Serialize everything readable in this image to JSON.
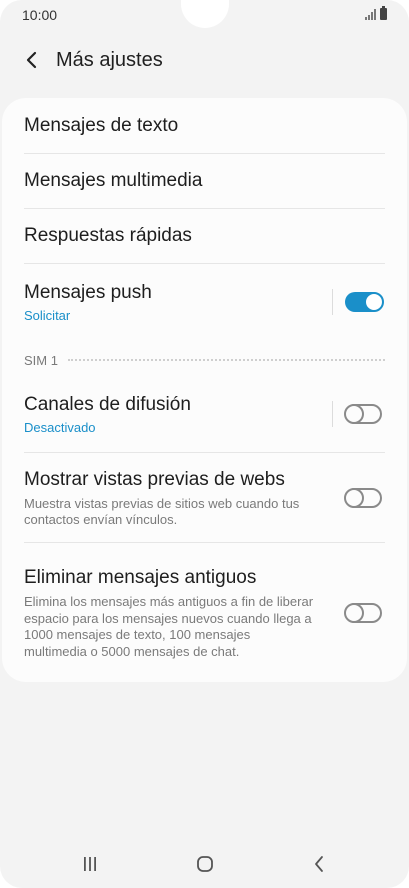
{
  "status_bar": {
    "time": "10:00"
  },
  "header": {
    "title": "Más ajustes"
  },
  "settings": {
    "text_messages": "Mensajes de texto",
    "multimedia_messages": "Mensajes multimedia",
    "quick_responses": "Respuestas rápidas",
    "push_messages": {
      "title": "Mensajes push",
      "subtitle": "Solicitar",
      "enabled": true
    },
    "sim_section": "SIM 1",
    "broadcast_channels": {
      "title": "Canales de difusión",
      "subtitle": "Desactivado",
      "enabled": false
    },
    "web_previews": {
      "title": "Mostrar vistas previas de webs",
      "subtitle": "Muestra vistas previas de sitios web cuando tus contactos envían vínculos.",
      "enabled": false
    },
    "delete_old": {
      "title": "Eliminar mensajes antiguos",
      "subtitle": "Elimina los mensajes más antiguos a fin de liberar espacio para los mensajes nuevos cuando llega a 1000 mensajes de texto, 100 mensajes multimedia o 5000 mensajes de chat.",
      "enabled": false
    }
  },
  "colors": {
    "accent": "#1a8fc9",
    "background": "#f3f3f3",
    "card": "#fcfcfc"
  },
  "icons": {
    "back": "chevron-left-icon",
    "recents": "recents-icon",
    "home": "home-icon",
    "nav_back": "nav-back-icon"
  }
}
